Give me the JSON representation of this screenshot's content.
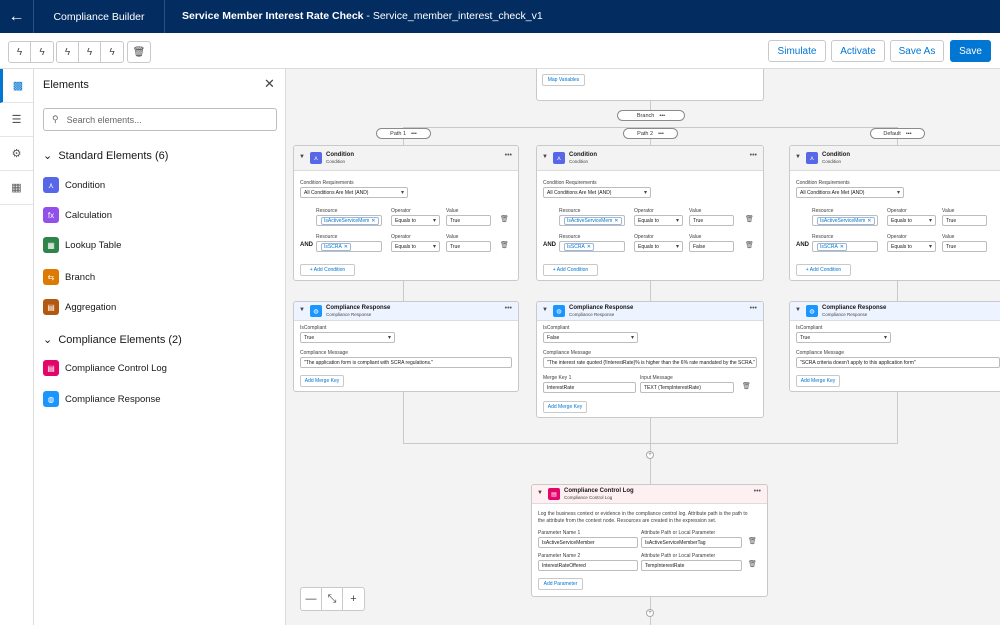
{
  "header": {
    "back_icon": "arrow-left-icon",
    "app_name": "Compliance Builder",
    "page_title_bold": "Service Member Interest Rate Check",
    "page_title_sep": " - ",
    "page_title_version": "Service_member_interest_check_v1"
  },
  "toolbar": {
    "simulate": "Simulate",
    "activate": "Activate",
    "save_as": "Save As",
    "save": "Save",
    "glyph": "ϟ",
    "trash": "🗑"
  },
  "rail": {
    "items": [
      "elements-icon",
      "list-icon",
      "gear-icon",
      "resources-icon"
    ]
  },
  "panel": {
    "title": "Elements",
    "close": "✕",
    "search_placeholder": "Search elements...",
    "standard_title": "Standard Elements (6)",
    "standard": [
      {
        "label": "Condition",
        "color": "#5867e8",
        "glyph": "⋏"
      },
      {
        "label": "Calculation",
        "color": "#9050e9",
        "glyph": "fx"
      },
      {
        "label": "Lookup Table",
        "color": "#2e844a",
        "glyph": "▦"
      },
      {
        "label": "Branch",
        "color": "#dd7a01",
        "glyph": "⇆"
      },
      {
        "label": "Aggregation",
        "color": "#b5580f",
        "glyph": "▤"
      }
    ],
    "compliance_title": "Compliance Elements (2)",
    "compliance": [
      {
        "label": "Compliance Control Log",
        "color": "#e3066a",
        "glyph": "▤"
      },
      {
        "label": "Compliance Response",
        "color": "#1b96ff",
        "glyph": "◍"
      }
    ]
  },
  "canvas": {
    "map_variables": "Map Variables",
    "branch": "Branch",
    "paths": [
      "Path 1",
      "Path 2",
      "Default"
    ],
    "more": "•••",
    "condition": {
      "title": "Condition",
      "subtitle": "Condition",
      "req_label": "Condition Requirements",
      "req_value": "All Conditions Are Met (AND)",
      "resource": "Resource",
      "operator": "Operator",
      "value": "Value",
      "rows": [
        {
          "resource": "IsActiveServiceMem",
          "operator": "Equals to",
          "value": "True"
        },
        {
          "resource": "IsSCRA",
          "operator": "Equals to",
          "value": "True"
        }
      ],
      "and": "AND",
      "add_condition": "+ Add Condition",
      "path2_values": [
        "True",
        "False"
      ]
    },
    "response": {
      "title": "Compliance Response",
      "subtitle": "Compliance Response",
      "is_compliant": "IsCompliant",
      "message_label": "Compliance Message",
      "p1_value": "True",
      "p1_message": "\"The application form is compliant with SCRA regulations.\"",
      "p2_value": "False",
      "p2_message": "\"The interest rate quoted {!InterestRate}% is higher than the 6% rate mandated by the SCRA.\"",
      "merge_key_label": "Merge Key 1",
      "input_message_label": "Input Message",
      "merge_key": "InterestRate",
      "input_message": "TEXT (TempInterestRate)",
      "p3_value": "True",
      "p3_message": "\"SCRA criteria doesn't apply to this application form\"",
      "add_merge_key": "Add Merge Key"
    },
    "control_log": {
      "title": "Compliance Control Log",
      "subtitle": "Compliance Control Log",
      "desc_1": "Log the business context or evidence in the compliance control log. Attribute path is the path to",
      "desc_2": "the attribute from the context node. Resources are created in the expression set.",
      "param1_label": "Parameter Name 1",
      "attr_label": "Attribute Path or Local Parameter",
      "param2_label": "Parameter Name 2",
      "param1": "IsActiveServiceMember",
      "attr1": "IsActiveServiceMemberTag",
      "param2": "InterestRateOffered",
      "attr2": "TempInterestRate",
      "add_parameter": "Add Parameter"
    },
    "zoom": {
      "minus": "—",
      "fit": "⤡",
      "plus": "+"
    }
  }
}
